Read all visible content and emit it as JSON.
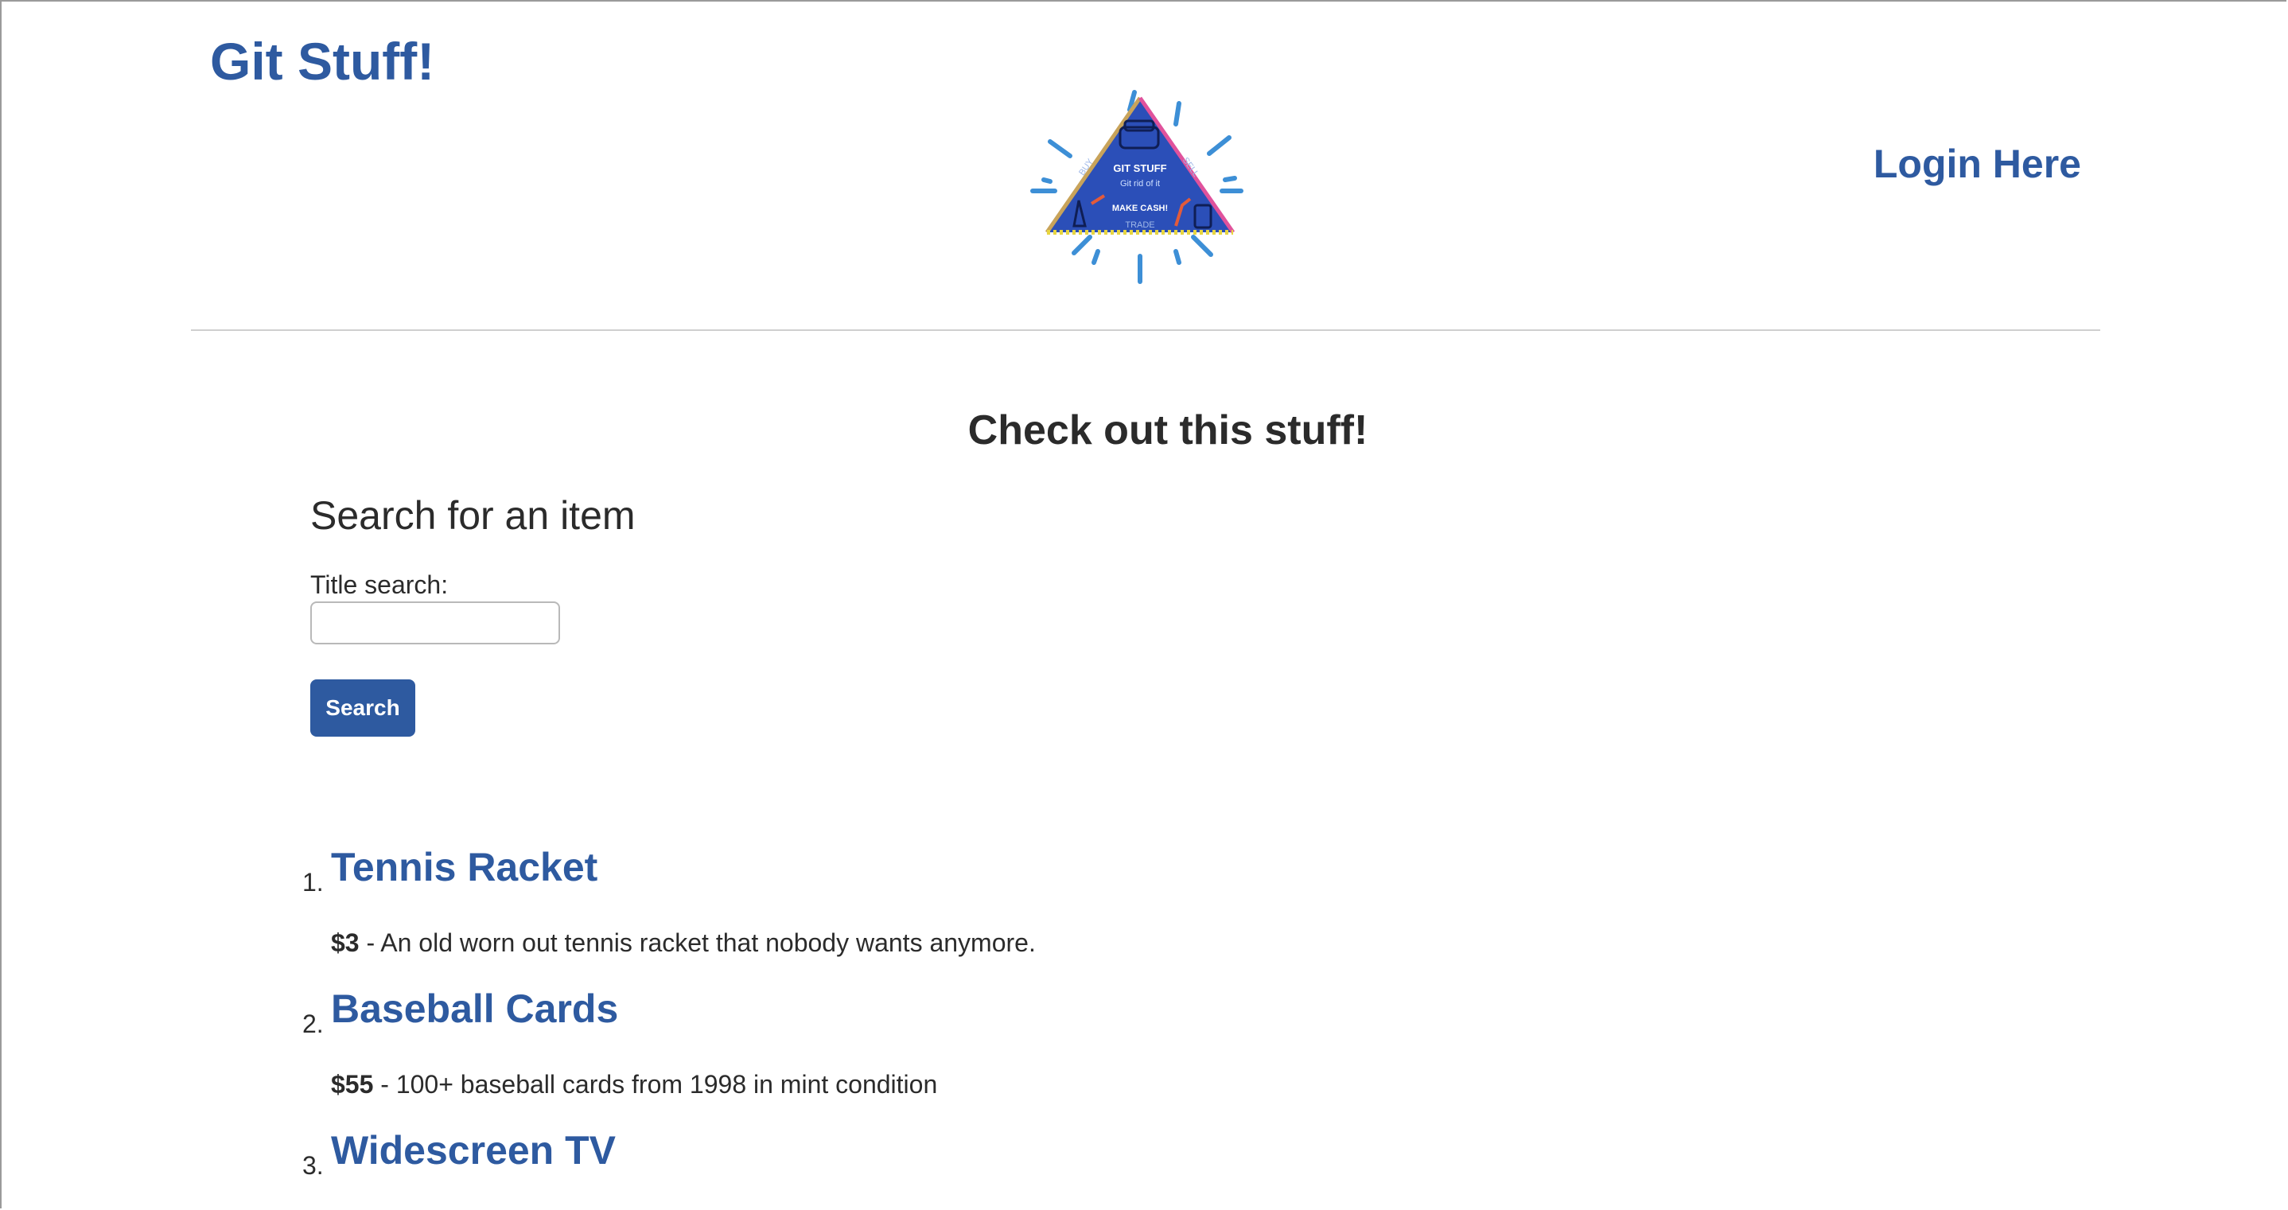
{
  "header": {
    "brand": "Git Stuff!",
    "login_label": "Login Here"
  },
  "logo": {
    "title": "GIT STUFF",
    "tagline": "Git rid of it",
    "buy": "BUY",
    "sell": "SELL",
    "make_cash": "MAKE CASH!",
    "trade": "TRADE",
    "colors": {
      "fill": "#2b4fb8",
      "burst": "#3d8fd6",
      "edge_left": "#c8a35a",
      "edge_right": "#e0529c",
      "edge_bottom": "#e8d640"
    }
  },
  "main": {
    "title": "Check out this stuff!",
    "search": {
      "heading": "Search for an item",
      "label": "Title search:",
      "value": "",
      "placeholder": "",
      "button_label": "Search"
    },
    "items": [
      {
        "number": "1.",
        "title": "Tennis Racket",
        "price": "$3",
        "description": " - An old worn out tennis racket that nobody wants anymore."
      },
      {
        "number": "2.",
        "title": "Baseball Cards",
        "price": "$55",
        "description": " - 100+ baseball cards from 1998 in mint condition"
      },
      {
        "number": "3.",
        "title": "Widescreen TV",
        "price": "",
        "description": ""
      }
    ]
  },
  "theme": {
    "accent": "#2e5aa0",
    "text": "#2b2b2b",
    "divider": "#cfcfcf"
  }
}
